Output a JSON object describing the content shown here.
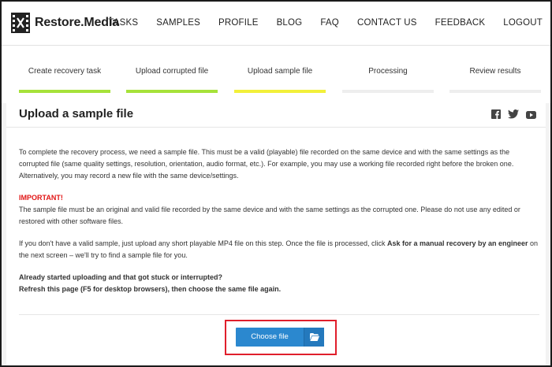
{
  "header": {
    "logo_text": "Restore.Media",
    "nav": [
      "TASKS",
      "SAMPLES",
      "PROFILE",
      "BLOG",
      "FAQ",
      "CONTACT US",
      "FEEDBACK",
      "LOGOUT"
    ]
  },
  "steps": [
    {
      "label": "Create recovery task",
      "state": "done",
      "color": "#a6e23a"
    },
    {
      "label": "Upload corrupted file",
      "state": "done",
      "color": "#a6e23a"
    },
    {
      "label": "Upload sample file",
      "state": "current",
      "color": "#f2f03a"
    },
    {
      "label": "Processing",
      "state": "pending",
      "color": "#eeeeee"
    },
    {
      "label": "Review results",
      "state": "pending",
      "color": "#eeeeee"
    }
  ],
  "page": {
    "title": "Upload a sample file",
    "social_icons": [
      "facebook-icon",
      "twitter-icon",
      "youtube-icon"
    ],
    "intro": "To complete the recovery process, we need a sample file. This must be a valid (playable) file recorded on the same device and with the same settings as the corrupted file (same quality settings, resolution, orientation, audio format, etc.). For example, you may use a working file recorded right before the broken one. Alternatively, you may record a new file with the same device/settings.",
    "important_label": "IMPORTANT!",
    "important_text": "The sample file must be an original and valid file recorded by the same device and with the same settings as the corrupted one. Please do not use any edited or restored with other software files.",
    "fallback_before": "If you don't have a valid sample, just upload any short playable MP4 file on this step. Once the file is processed, click ",
    "fallback_bold": "Ask for a manual recovery by an engineer",
    "fallback_after": " on the next screen – we'll try to find a sample file for you.",
    "stuck_line1": "Already started uploading and that got stuck or interrupted?",
    "stuck_line2": "Refresh this page (F5 for desktop browsers), then choose the same file again."
  },
  "upload": {
    "button_label": "Choose file",
    "button_icon": "folder-open-icon",
    "accent": "#2b88cf",
    "highlight": "#e01e2b"
  }
}
